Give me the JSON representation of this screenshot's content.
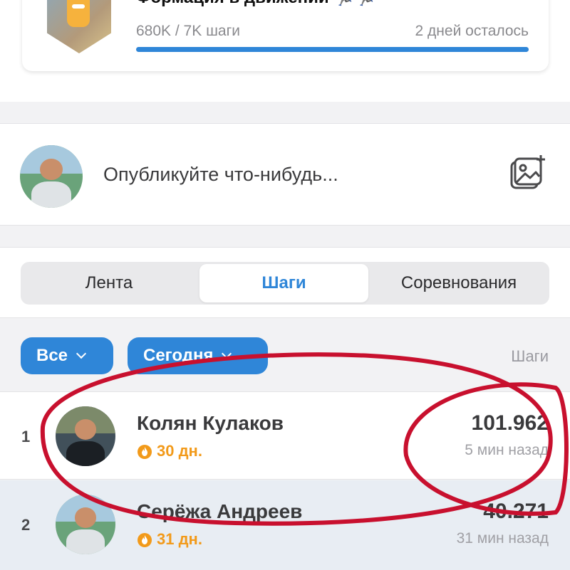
{
  "challenge": {
    "title": "Формация в движении 🏃‍♂️🏃",
    "progress_text": "680K / 7K шаги",
    "days_left": "2 дней осталось",
    "progress": 1.0
  },
  "composer": {
    "placeholder": "Опубликуйте что-нибудь...",
    "icon": "add-photo-icon"
  },
  "tabs": [
    {
      "label": "Лента"
    },
    {
      "label": "Шаги",
      "active": true
    },
    {
      "label": "Соревнования"
    }
  ],
  "filters": {
    "all_label": "Все",
    "period_label": "Сегодня",
    "column_label": "Шаги"
  },
  "leaderboard": [
    {
      "rank": "1",
      "name": "Колян Кулаков",
      "streak": "30 дн.",
      "steps": "101.962",
      "ago": "5 мин назад"
    },
    {
      "rank": "2",
      "name": "Серёжа Андреев",
      "streak": "31 дн.",
      "steps": "40.271",
      "ago": "31 мин назад"
    }
  ],
  "colors": {
    "accent": "#2f86d8",
    "streak": "#f29a1a",
    "annotation": "#c8102e"
  }
}
